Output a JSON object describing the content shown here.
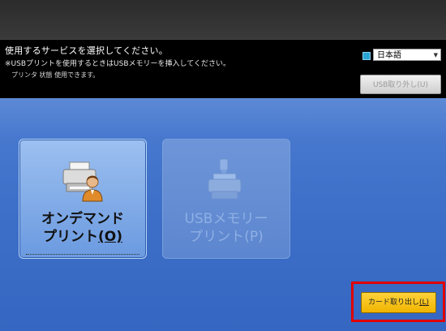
{
  "header": {
    "instruction": "使用するサービスを選択してください。",
    "usb_note": "※USBプリントを使用するときはUSBメモリーを挿入してください。",
    "status": "プリンタ 状態 使用できます。"
  },
  "language": {
    "selected": "日本語",
    "icon": "flag-icon"
  },
  "buttons": {
    "usb_eject": "USB取り外し",
    "usb_eject_key": "(U)",
    "card_eject": "カード取り出し",
    "card_eject_key": "(L)"
  },
  "tiles": [
    {
      "line1": "オンデマンド",
      "line2": "プリント",
      "key": "(O)",
      "icon": "printer-with-person-icon",
      "enabled": true
    },
    {
      "line1": "USBメモリー",
      "line2": "プリント",
      "key": "(P)",
      "icon": "usb-printer-icon",
      "enabled": false
    }
  ],
  "colors": {
    "background": "#3e70c9",
    "highlight": "#e00000",
    "card_button": "#f0b400"
  }
}
